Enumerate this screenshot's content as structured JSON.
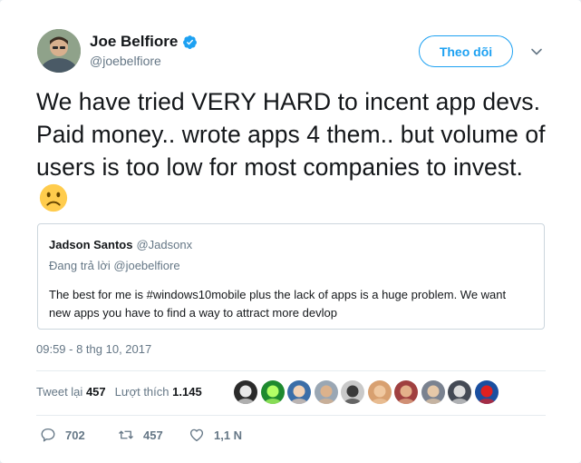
{
  "author": {
    "name": "Joe Belfiore",
    "handle": "@joebelfiore",
    "verified_color": "#1da1f2"
  },
  "follow_label": "Theo dõi",
  "tweet": {
    "text": "We have tried VERY HARD to incent app devs. Paid money.. wrote apps 4 them.. but volume of users is too low for most companies to invest.",
    "emoji": "slightly-frowning-face"
  },
  "quote": {
    "name": "Jadson Santos",
    "handle": "@Jadsonx",
    "reply_to": "Đang trả lời @joebelfiore",
    "text": "The best for me is #windows10mobile  plus the lack of apps is a huge problem. We want new apps you have to find a way to attract more devlop"
  },
  "timestamp": "09:59 - 8 thg 10, 2017",
  "stats": {
    "retweets_label": "Tweet lại",
    "retweets_count": "457",
    "likes_label": "Lượt thích",
    "likes_count": "1.145"
  },
  "likers": [
    {
      "name": "liker-avatar-1",
      "bg": "#2b2b2b",
      "fg": "#e8e8e8"
    },
    {
      "name": "liker-avatar-2",
      "bg": "#1e8a2f",
      "fg": "#b3ff66"
    },
    {
      "name": "liker-avatar-3",
      "bg": "#3b6ea8",
      "fg": "#f2d2b6"
    },
    {
      "name": "liker-avatar-4",
      "bg": "#9aa7b4",
      "fg": "#dcb28c"
    },
    {
      "name": "liker-avatar-5",
      "bg": "#c9c9c9",
      "fg": "#3a3a3a"
    },
    {
      "name": "liker-avatar-6",
      "bg": "#d8a070",
      "fg": "#f0c8a0"
    },
    {
      "name": "liker-avatar-7",
      "bg": "#a04040",
      "fg": "#e4b08a"
    },
    {
      "name": "liker-avatar-8",
      "bg": "#7a8290",
      "fg": "#e6c8a8"
    },
    {
      "name": "liker-avatar-9",
      "bg": "#444a55",
      "fg": "#dddddd"
    },
    {
      "name": "liker-avatar-10",
      "bg": "#1a4fa0",
      "fg": "#e02020"
    }
  ],
  "actions": {
    "reply_count": "702",
    "retweet_count": "457",
    "like_count": "1,1 N"
  }
}
